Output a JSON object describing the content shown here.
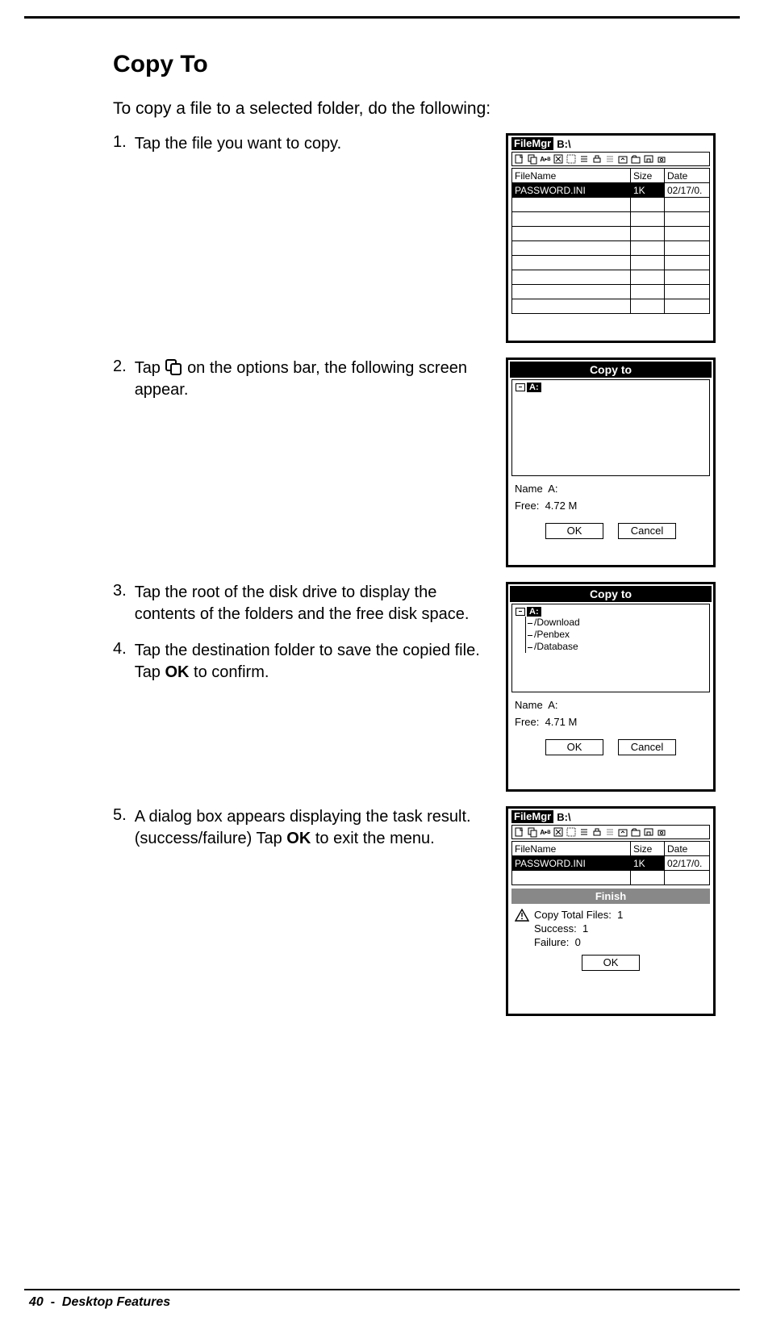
{
  "heading": "Copy To",
  "intro": "To copy a file to a selected folder, do the following:",
  "steps": {
    "s1": {
      "num": "1.",
      "text": "Tap the file you want to copy."
    },
    "s2": {
      "num": "2.",
      "pre": "Tap ",
      "post": " on the options bar, the following screen appear."
    },
    "s3": {
      "num": "3.",
      "text": "Tap the root of the disk drive to display the contents of the folders and the free disk space."
    },
    "s4": {
      "num": "4.",
      "pre": "Tap the destination folder to save the copied file. Tap ",
      "bold": "OK",
      "post": " to confirm."
    },
    "s5": {
      "num": "5.",
      "pre": "A dialog box appears displaying the task result. (success/failure) Tap ",
      "bold": "OK",
      "post": " to exit the menu."
    }
  },
  "filemgr": {
    "app": "FileMgr",
    "path": "B:\\",
    "headers": {
      "name": "FileName",
      "size": "Size",
      "date": "Date"
    },
    "row": {
      "name": "PASSWORD.INI",
      "size": "1K",
      "date": "02/17/0."
    }
  },
  "copyto1": {
    "title": "Copy to",
    "drive": "A:",
    "name_label": "Name",
    "name_value": "A:",
    "free_label": "Free:",
    "free_value": "4.72 M",
    "ok": "OK",
    "cancel": "Cancel"
  },
  "copyto2": {
    "title": "Copy to",
    "drive": "A:",
    "folders": [
      "/Download",
      "/Penbex",
      "/Database"
    ],
    "name_label": "Name",
    "name_value": "A:",
    "free_label": "Free:",
    "free_value": "4.71 M",
    "ok": "OK",
    "cancel": "Cancel"
  },
  "finish": {
    "app": "FileMgr",
    "path": "B:\\",
    "headers": {
      "name": "FileName",
      "size": "Size",
      "date": "Date"
    },
    "row": {
      "name": "PASSWORD.INI",
      "size": "1K",
      "date": "02/17/0."
    },
    "bar": "Finish",
    "total_label": "Copy Total Files:",
    "total": "1",
    "success_label": "Success:",
    "success": "1",
    "failure_label": "Failure:",
    "failure": "0",
    "ok": "OK"
  },
  "footer": {
    "page": "40",
    "sep": "-",
    "section": "Desktop Features"
  }
}
